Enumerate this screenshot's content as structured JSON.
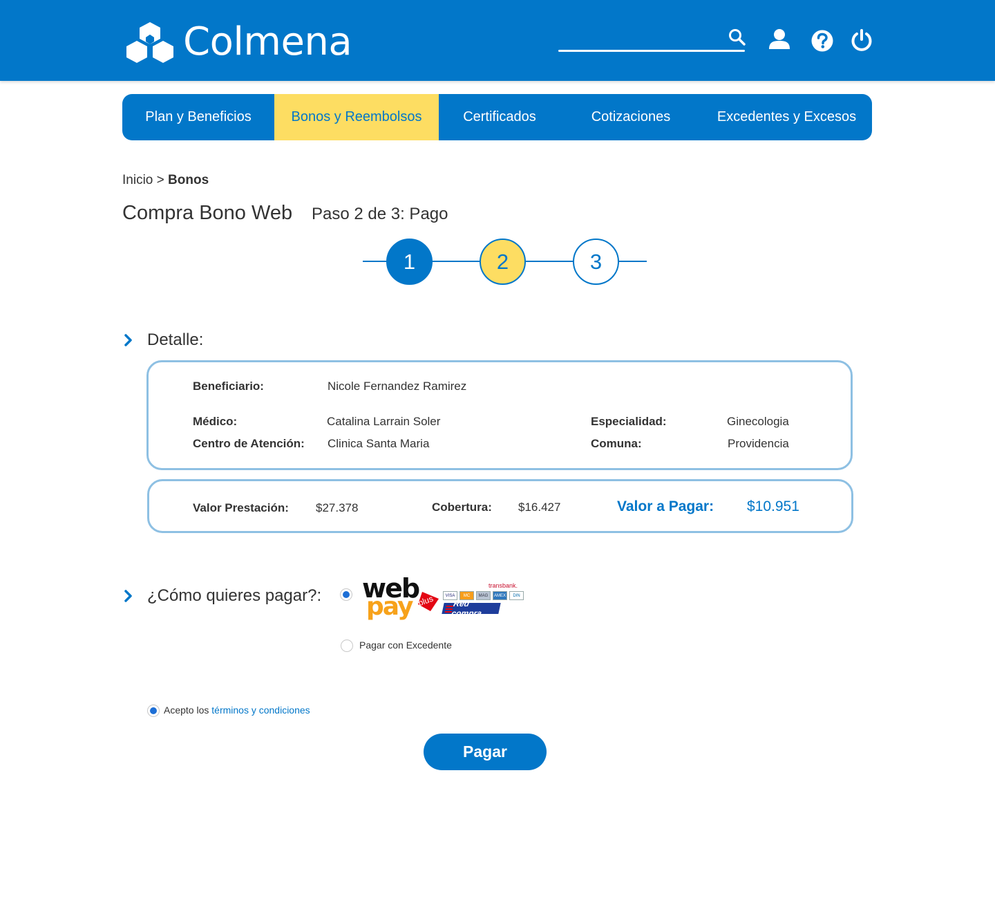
{
  "app": {
    "brand": "Colmena"
  },
  "colors": {
    "primary": "#0277c9",
    "accent": "#fddd62",
    "card_border": "#8ec0e3"
  },
  "header": {
    "icons": [
      "search-icon",
      "user-icon",
      "help-icon",
      "power-icon"
    ]
  },
  "nav": {
    "items": [
      {
        "label": "Plan y Beneficios",
        "active": false
      },
      {
        "label": "Bonos y Reembolsos",
        "active": true
      },
      {
        "label": "Certificados",
        "active": false
      },
      {
        "label": "Cotizaciones",
        "active": false
      },
      {
        "label": "Excedentes y Excesos",
        "active": false
      }
    ]
  },
  "breadcrumb": {
    "home": "Inicio",
    "separator": ">",
    "current": "Bonos"
  },
  "page": {
    "title": "Compra Bono Web",
    "step_text": "Paso 2 de 3: Pago"
  },
  "stepper": {
    "steps": [
      "1",
      "2",
      "3"
    ],
    "current": 2
  },
  "detail": {
    "heading": "Detalle:",
    "beneficiario_label": "Beneficiario:",
    "beneficiario_value": "Nicole Fernandez Ramirez",
    "medico_label": "Médico:",
    "medico_value": "Catalina Larrain Soler",
    "especialidad_label": "Especialidad:",
    "especialidad_value": "Ginecologia",
    "centro_label": "Centro de Atención:",
    "centro_value": "Clinica Santa Maria",
    "comuna_label": "Comuna:",
    "comuna_value": "Providencia"
  },
  "totals": {
    "valor_prestacion_label": "Valor Prestación:",
    "valor_prestacion_value": "$27.378",
    "cobertura_label": "Cobertura:",
    "cobertura_value": "$16.427",
    "valor_pagar_label": "Valor a Pagar:",
    "valor_pagar_value": "$10.951"
  },
  "payment": {
    "heading": "¿Cómo quieres pagar?:",
    "webpay": {
      "web": "web",
      "pay": "pay",
      "plus": "plus",
      "transbank": "transbank.",
      "cards": [
        "VISA",
        "MC",
        "MAG",
        "AMEX",
        "DIN"
      ],
      "redcompra": "Red compra"
    },
    "option_webpay_selected": true,
    "option_excedente_label": "Pagar con Excedente",
    "option_excedente_selected": false
  },
  "terms": {
    "prefix": "Acepto los",
    "link": "términos y condiciones",
    "checked": true
  },
  "actions": {
    "pay_label": "Pagar"
  }
}
